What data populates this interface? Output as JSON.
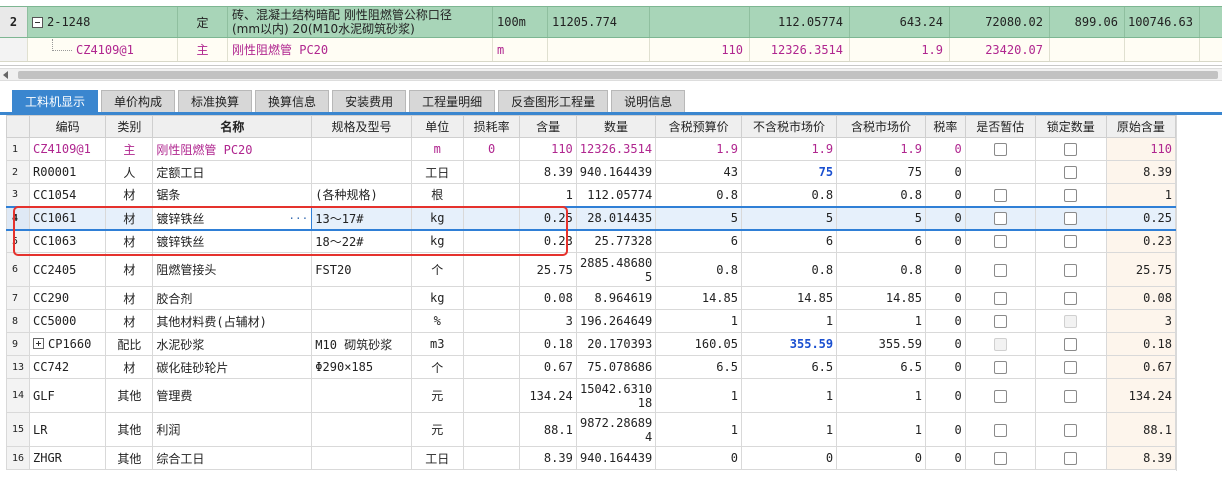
{
  "top_grid": {
    "row1": {
      "rownum": "2",
      "code": "2-1248",
      "type": "定",
      "name_line1": "砖、混凝土结构暗配 刚性阻燃管公称口径",
      "name_line2": "(mm以内) 20(M10水泥砌筑砂浆)",
      "unit": "100m",
      "qty": "11205.774",
      "price": "112.05774",
      "v2": "643.24",
      "v3": "72080.02",
      "v4": "899.06",
      "v5": "100746.63"
    },
    "row2": {
      "code": "CZ4109@1",
      "type": "主",
      "name": "刚性阻燃管 PC20",
      "unit": "m",
      "qty": "110",
      "price": "12326.3514",
      "v2": "1.9",
      "v3": "23420.07"
    }
  },
  "tabs": [
    "工料机显示",
    "单价构成",
    "标准换算",
    "换算信息",
    "安装费用",
    "工程量明细",
    "反查图形工程量",
    "说明信息"
  ],
  "active_tab": 0,
  "columns": [
    "编码",
    "类别",
    "名称",
    "规格及型号",
    "单位",
    "损耗率",
    "含量",
    "数量",
    "含税预算价",
    "不含税市场价",
    "含税市场价",
    "税率",
    "是否暂估",
    "锁定数量",
    "原始含量"
  ],
  "rows": [
    {
      "n": "1",
      "code": "CZ4109@1",
      "type": "主",
      "name": "刚性阻燃管 PC20",
      "spec": "",
      "unit": "m",
      "loss": "0",
      "content": "110",
      "qty": "12326.3514",
      "p1": "1.9",
      "p2": "1.9",
      "p3": "1.9",
      "tax": "0",
      "est": true,
      "lock": true,
      "orig": "110"
    },
    {
      "n": "2",
      "code": "R00001",
      "type": "人",
      "name": "定额工日",
      "spec": "",
      "unit": "工日",
      "loss": "",
      "content": "8.39",
      "qty": "940.164439",
      "p1": "43",
      "p2": "75",
      "p3": "75",
      "tax": "0",
      "est": false,
      "lock": true,
      "orig": "8.39"
    },
    {
      "n": "3",
      "code": "CC1054",
      "type": "材",
      "name": "锯条",
      "spec": "(各种规格)",
      "unit": "根",
      "loss": "",
      "content": "1",
      "qty": "112.05774",
      "p1": "0.8",
      "p2": "0.8",
      "p3": "0.8",
      "tax": "0",
      "est": true,
      "lock": true,
      "orig": "1"
    },
    {
      "n": "4",
      "code": "CC1061",
      "type": "材",
      "name": "镀锌铁丝",
      "spec": "13～17#",
      "unit": "kg",
      "loss": "",
      "content": "0.25",
      "qty": "28.014435",
      "p1": "5",
      "p2": "5",
      "p3": "5",
      "tax": "0",
      "est": true,
      "lock": true,
      "orig": "0.25"
    },
    {
      "n": "5",
      "code": "CC1063",
      "type": "材",
      "name": "镀锌铁丝",
      "spec": "18～22#",
      "unit": "kg",
      "loss": "",
      "content": "0.23",
      "qty": "25.77328",
      "p1": "6",
      "p2": "6",
      "p3": "6",
      "tax": "0",
      "est": true,
      "lock": true,
      "orig": "0.23"
    },
    {
      "n": "6",
      "code": "CC2405",
      "type": "材",
      "name": "阻燃管接头",
      "spec": "FST20",
      "unit": "个",
      "loss": "",
      "content": "25.75",
      "qty_l1": "2885.48680",
      "qty_l2": "5",
      "p1": "0.8",
      "p2": "0.8",
      "p3": "0.8",
      "tax": "0",
      "est": true,
      "lock": true,
      "orig": "25.75"
    },
    {
      "n": "7",
      "code": "CC290",
      "type": "材",
      "name": "胶合剂",
      "spec": "",
      "unit": "kg",
      "loss": "",
      "content": "0.08",
      "qty": "8.964619",
      "p1": "14.85",
      "p2": "14.85",
      "p3": "14.85",
      "tax": "0",
      "est": true,
      "lock": true,
      "orig": "0.08"
    },
    {
      "n": "8",
      "code": "CC5000",
      "type": "材",
      "name": "其他材料费(占辅材)",
      "spec": "",
      "unit": "%",
      "loss": "",
      "content": "3",
      "qty": "196.264649",
      "p1": "1",
      "p2": "1",
      "p3": "1",
      "tax": "0",
      "est": true,
      "lock": "dis",
      "orig": "3"
    },
    {
      "n": "9",
      "code": "CP1660",
      "type": "配比",
      "name": "水泥砂浆",
      "spec": "M10 砌筑砂浆",
      "unit": "m3",
      "loss": "",
      "content": "0.18",
      "qty": "20.170393",
      "p1": "160.05",
      "p2": "355.59",
      "p3": "355.59",
      "tax": "0",
      "est": "dis",
      "lock": true,
      "orig": "0.18"
    },
    {
      "n": "13",
      "code": "CC742",
      "type": "材",
      "name": "碳化硅砂轮片",
      "spec": "Φ290×185",
      "unit": "个",
      "loss": "",
      "content": "0.67",
      "qty": "75.078686",
      "p1": "6.5",
      "p2": "6.5",
      "p3": "6.5",
      "tax": "0",
      "est": true,
      "lock": true,
      "orig": "0.67"
    },
    {
      "n": "14",
      "code": "GLF",
      "type": "其他",
      "name": "管理费",
      "spec": "",
      "unit": "元",
      "loss": "",
      "content": "134.24",
      "qty_l1": "15042.6310",
      "qty_l2": "18",
      "p1": "1",
      "p2": "1",
      "p3": "1",
      "tax": "0",
      "est": true,
      "lock": true,
      "orig": "134.24"
    },
    {
      "n": "15",
      "code": "LR",
      "type": "其他",
      "name": "利润",
      "spec": "",
      "unit": "元",
      "loss": "",
      "content": "88.1",
      "qty_l1": "9872.28689",
      "qty_l2": "4",
      "p1": "1",
      "p2": "1",
      "p3": "1",
      "tax": "0",
      "est": true,
      "lock": true,
      "orig": "88.1"
    },
    {
      "n": "16",
      "code": "ZHGR",
      "type": "其他",
      "name": "综合工日",
      "spec": "",
      "unit": "工日",
      "loss": "",
      "content": "8.39",
      "qty": "940.164439",
      "p1": "0",
      "p2": "0",
      "p3": "0",
      "tax": "0",
      "est": true,
      "lock": true,
      "orig": "8.39"
    }
  ],
  "colors": {
    "accent": "#3a86cf",
    "highlight": "#e5322d",
    "quota_row": "#a8d5b8",
    "main_material": "#b0268f",
    "market_price_changed": "#1a4fd0"
  }
}
